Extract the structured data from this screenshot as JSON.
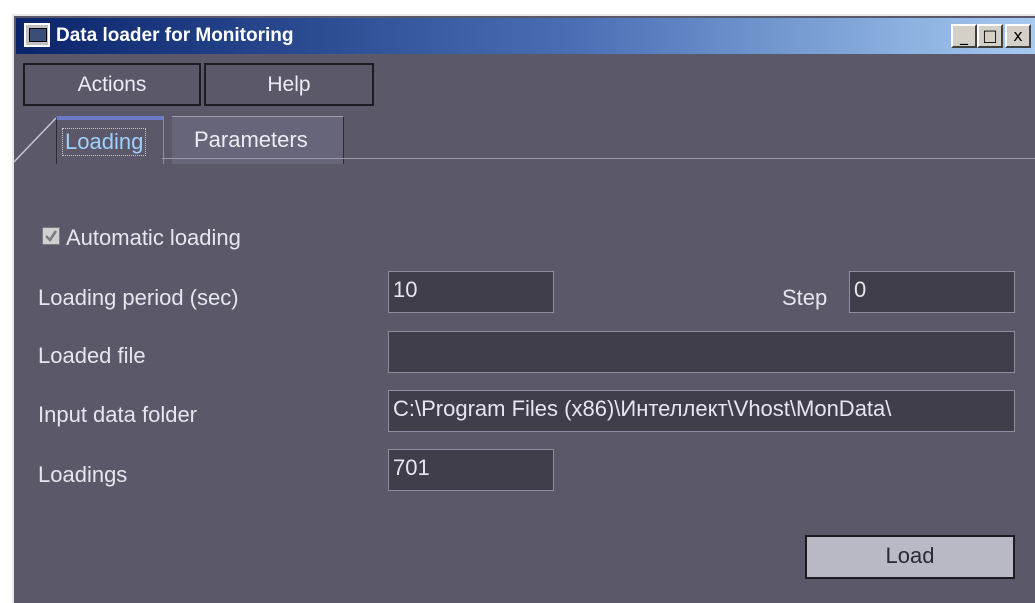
{
  "window": {
    "title": "Data loader for Monitoring",
    "controls": {
      "minimize": "_",
      "maximize": "□",
      "close": "x"
    }
  },
  "menu": {
    "actions_label": "Actions",
    "help_label": "Help"
  },
  "tabs": [
    {
      "label": "Loading",
      "active": true
    },
    {
      "label": "Parameters",
      "active": false
    }
  ],
  "form": {
    "automatic_loading": {
      "label": "Automatic loading",
      "checked": true
    },
    "loading_period": {
      "label": "Loading period (sec)",
      "value": "10"
    },
    "step": {
      "label": "Step",
      "value": "0"
    },
    "loaded_file": {
      "label": "Loaded file",
      "value": ""
    },
    "input_data_folder": {
      "label": "Input data folder",
      "value": "C:\\Program Files (x86)\\Интеллект\\Vhost\\MonData\\"
    },
    "loadings": {
      "label": "Loadings",
      "value": "701"
    }
  },
  "load_button": "Load",
  "colors": {
    "window_bg": "#5a5869",
    "active_tab_text": "#9fd0ff",
    "titlebar_start": "#0a246a",
    "titlebar_end": "#a6caf0"
  }
}
